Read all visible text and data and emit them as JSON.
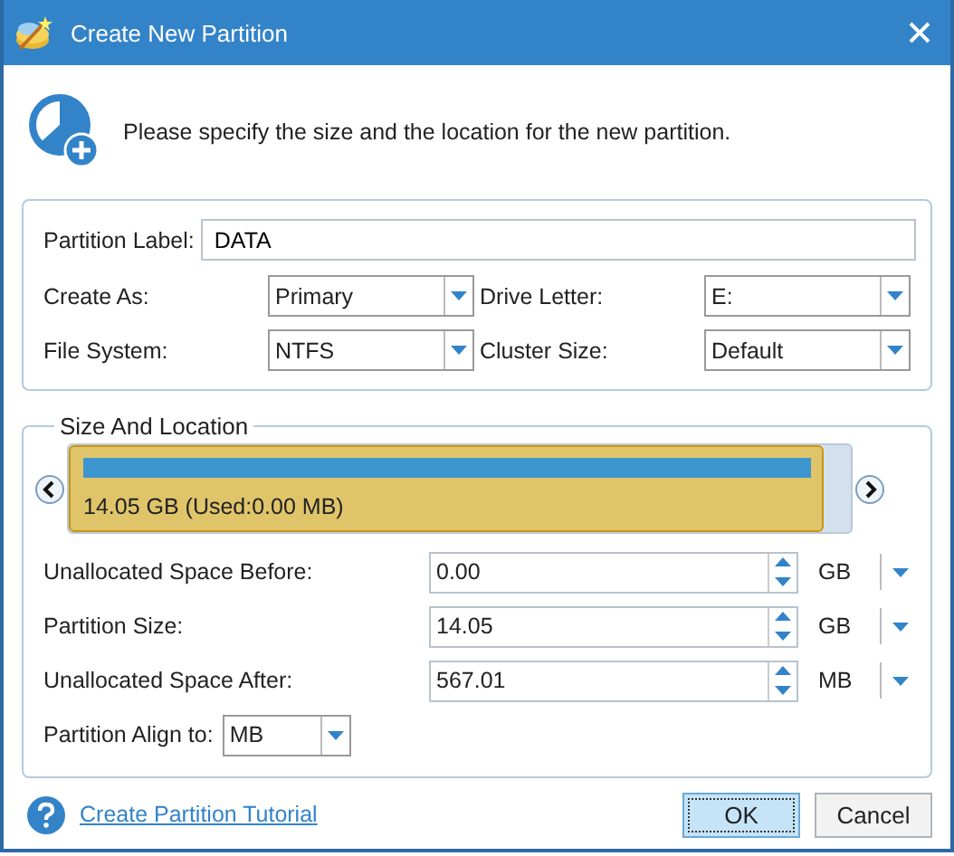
{
  "window": {
    "title": "Create New Partition"
  },
  "intro": "Please specify the size and the location for the new partition.",
  "partition_label": {
    "label": "Partition Label:",
    "value": "DATA"
  },
  "combos": [
    {
      "label": "Create As:",
      "value": "Primary"
    },
    {
      "label": "Drive Letter:",
      "value": "E:"
    },
    {
      "label": "File System:",
      "value": "NTFS"
    },
    {
      "label": "Cluster Size:",
      "value": "Default"
    }
  ],
  "size_and_location": {
    "title": "Size And Location",
    "disk_map": {
      "text": "14.05 GB (Used:0.00 MB)",
      "level": 0.965
    },
    "spin_rows": [
      {
        "label": "Unallocated Space Before:",
        "value": "0.00",
        "unit": "GB"
      },
      {
        "label": "Partition Size:",
        "value": "14.05",
        "unit": "GB"
      },
      {
        "label": "Unallocated Space After:",
        "value": "567.01",
        "unit": "MB"
      }
    ],
    "align": {
      "label": "Partition Align to:",
      "value": "MB"
    }
  },
  "help_link": "Create Partition Tutorial",
  "buttons": [
    {
      "label": "OK",
      "default": true
    },
    {
      "label": "Cancel",
      "default": false
    }
  ]
}
